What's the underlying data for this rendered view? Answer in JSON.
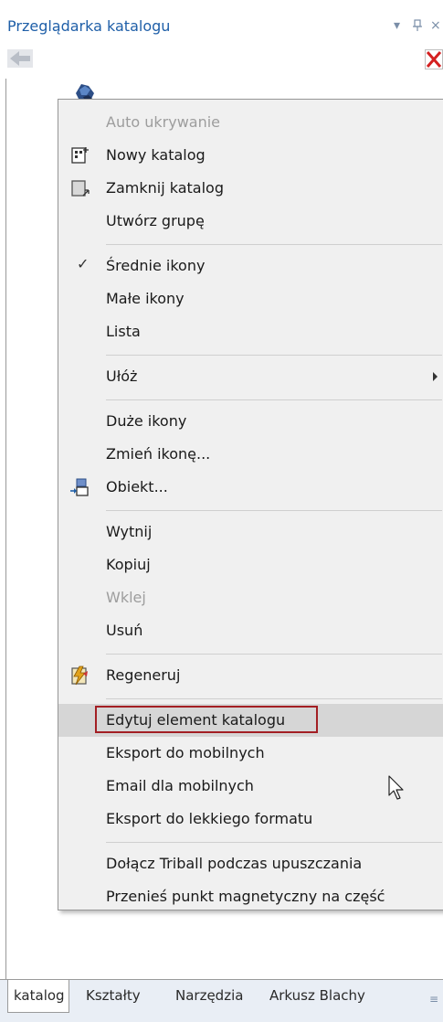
{
  "panel": {
    "title": "Przeglądarka katalogu",
    "controls": {
      "dropdown": "▾",
      "pin": "ꟼ",
      "close": "×"
    }
  },
  "toolbar": {
    "back_icon": "back-arrow-icon",
    "close_icon": "red-x-icon"
  },
  "menu": {
    "items": [
      {
        "label": "Auto ukrywanie",
        "disabled": true
      },
      {
        "label": "Nowy katalog",
        "icon": "new-catalog-icon"
      },
      {
        "label": "Zamknij katalog",
        "icon": "close-catalog-icon"
      },
      {
        "label": "Utwórz grupę"
      },
      {
        "label": "Średnie ikony",
        "checked": true
      },
      {
        "label": "Małe ikony"
      },
      {
        "label": "Lista"
      },
      {
        "label": "Ułóż",
        "submenu": true
      },
      {
        "label": "Duże ikony"
      },
      {
        "label": "Zmień ikonę..."
      },
      {
        "label": "Obiekt...",
        "icon": "object-icon"
      },
      {
        "label": "Wytnij"
      },
      {
        "label": "Kopiuj"
      },
      {
        "label": "Wklej",
        "disabled": true
      },
      {
        "label": "Usuń"
      },
      {
        "label": "Regeneruj",
        "icon": "regenerate-icon"
      },
      {
        "label": "Edytuj element katalogu",
        "hovered": true
      },
      {
        "label": "Eksport do mobilnych"
      },
      {
        "label": "Email dla mobilnych"
      },
      {
        "label": "Eksport do lekkiego formatu"
      },
      {
        "label": "Dołącz Triball podczas upuszczania"
      },
      {
        "label": "Przenieś punkt magnetyczny na część"
      }
    ],
    "check_glyph": "✓"
  },
  "tabs": [
    {
      "label": "katalog",
      "active": true
    },
    {
      "label": "Kształty"
    },
    {
      "label": "Narzędzia"
    },
    {
      "label": "Arkusz Blachy"
    }
  ],
  "tabs_menu_glyph": "≡",
  "colors": {
    "title": "#1f5fa8",
    "highlight_border": "#a31f24",
    "menu_bg": "#f0f0f0",
    "hover_bg": "#d6d6d6"
  }
}
